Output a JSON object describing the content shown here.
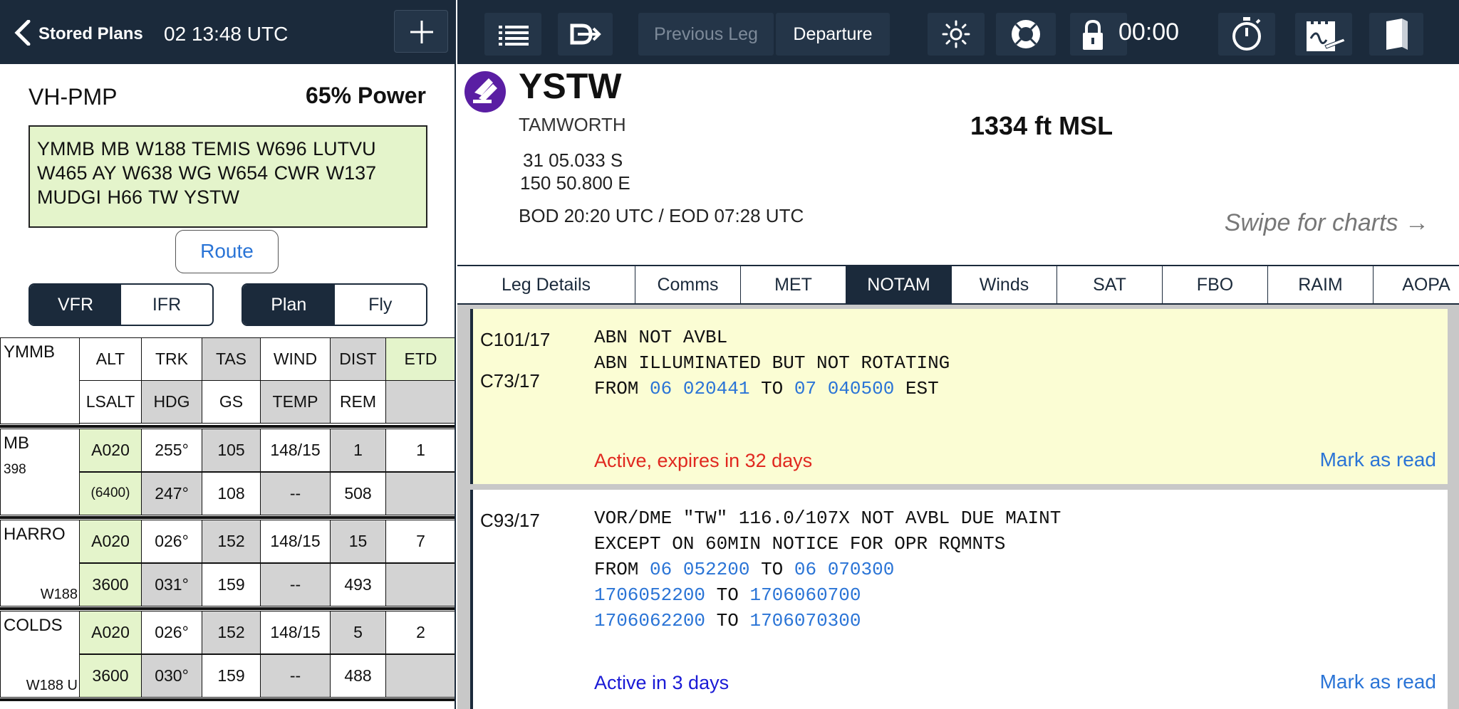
{
  "left_header": {
    "back_label": "Stored Plans",
    "time": "02 13:48 UTC"
  },
  "aircraft": {
    "registration": "VH-PMP",
    "power": "65% Power"
  },
  "route_text": "YMMB MB W188 TEMIS W696 LUTVU W465 AY W638 WG W654 CWR W137 MUDGI H66 TW YSTW",
  "route_button": "Route",
  "rules_toggle": {
    "vfr": "VFR",
    "ifr": "IFR",
    "selected": "VFR"
  },
  "mode_toggle": {
    "plan": "Plan",
    "fly": "Fly",
    "selected": "Plan"
  },
  "navlog": {
    "origin": "YMMB",
    "headers_row1": [
      "ALT",
      "TRK",
      "TAS",
      "WIND",
      "DIST",
      "ETD"
    ],
    "headers_row2": [
      "LSALT",
      "HDG",
      "GS",
      "TEMP",
      "REM",
      ""
    ],
    "legs": [
      {
        "name": "MB",
        "sub": "398",
        "airway": "",
        "alt": "A020",
        "trk": "255°",
        "tas": "105",
        "wind": "148/15",
        "dist": "1",
        "ete": "1",
        "lsalt": "(6400)",
        "hdg": "247°",
        "gs": "108",
        "temp": "--",
        "rem": "508"
      },
      {
        "name": "HARRO",
        "sub": "",
        "airway": "W188",
        "alt": "A020",
        "trk": "026°",
        "tas": "152",
        "wind": "148/15",
        "dist": "15",
        "ete": "7",
        "lsalt": "3600",
        "hdg": "031°",
        "gs": "159",
        "temp": "--",
        "rem": "493"
      },
      {
        "name": "COLDS",
        "sub": "",
        "airway": "W188 U",
        "alt": "A020",
        "trk": "026°",
        "tas": "152",
        "wind": "148/15",
        "dist": "5",
        "ete": "2",
        "lsalt": "3600",
        "hdg": "030°",
        "gs": "159",
        "temp": "--",
        "rem": "488"
      }
    ]
  },
  "toolbar": {
    "prev_leg": "Previous Leg",
    "departure": "Departure",
    "timer": "00:00"
  },
  "airport": {
    "ident": "YSTW",
    "name": "TAMWORTH",
    "elevation": "1334 ft MSL",
    "lat": "31 05.033 S",
    "lon": "150 50.800 E",
    "daylight": "BOD 20:20 UTC / EOD 07:28 UTC",
    "swipe_hint": "Swipe for charts →"
  },
  "tabs": {
    "items": [
      "Leg Details",
      "Comms",
      "MET",
      "NOTAM",
      "Winds",
      "SAT",
      "FBO",
      "RAIM",
      "AOPA"
    ],
    "selected": "NOTAM"
  },
  "notams": [
    {
      "ids": [
        "C101/17",
        "C73/17"
      ],
      "line1": "ABN NOT AVBL",
      "line2": "ABN ILLUMINATED BUT NOT ROTATING",
      "from_kw": "FROM",
      "from": "06 020441",
      "to_kw": "TO",
      "to": "07 040500",
      "suffix": "EST",
      "status": "Active, expires in 32 days",
      "status_color": "#e0281f",
      "mark": "Mark as read"
    },
    {
      "ids": [
        "C93/17"
      ],
      "line1": "VOR/DME \"TW\" 116.0/107X NOT AVBL DUE MAINT",
      "line2": "EXCEPT ON 60MIN NOTICE FOR OPR RQMNTS",
      "from_kw": "FROM",
      "from": "06 052200",
      "to_kw": "TO",
      "to": "06 070300",
      "ranges": [
        {
          "a": "1706052200",
          "to": "TO",
          "b": "1706060700"
        },
        {
          "a": "1706062200",
          "to": "TO",
          "b": "1706070300"
        }
      ],
      "status": "Active in 3 days",
      "status_color": "#1a1ad6",
      "mark": "Mark as read"
    }
  ],
  "colors": {
    "nav_bg": "#1b2a3b",
    "accent_blue": "#2a74d6",
    "route_bg": "#e4f4cb",
    "notam_active_bg": "#fbfdd4",
    "airport_icon": "#5a1ea3"
  },
  "icons": [
    "chevron-left-icon",
    "plus-icon",
    "list-icon",
    "direct-to-icon",
    "brightness-icon",
    "lifebuoy-icon",
    "lock-icon",
    "stopwatch-icon",
    "logbook-icon",
    "book-icon",
    "airport-icon"
  ]
}
